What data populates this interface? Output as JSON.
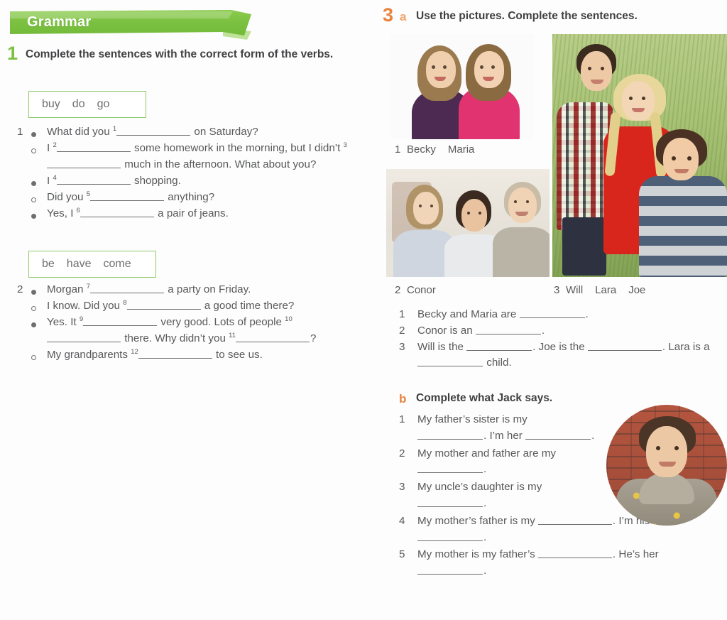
{
  "left": {
    "banner": {
      "label": "Grammar"
    },
    "exercise1": {
      "number": "1",
      "instruction": "Complete the sentences with the correct form of the verbs.",
      "verbbox1": {
        "v1": "buy",
        "v2": "do",
        "v3": "go"
      },
      "verbbox2": {
        "v1": "be",
        "v2": "have",
        "v3": "come"
      },
      "dialog1": {
        "number": "1",
        "lines": [
          {
            "bullet": "filled",
            "pre": "What did you ",
            "sup": "1",
            "mid": "",
            "post": " on Saturday?"
          },
          {
            "bullet": "hollow",
            "pre": "I ",
            "sup": "2",
            "mid": "",
            "post": " some homework in the morning, but I didn’t ",
            "sup2": "3",
            "post2": " much in the afternoon. What about you?"
          },
          {
            "bullet": "filled",
            "pre": "I ",
            "sup": "4",
            "post": " shopping."
          },
          {
            "bullet": "hollow",
            "pre": "Did you ",
            "sup": "5",
            "post": " anything?"
          },
          {
            "bullet": "filled",
            "pre": "Yes, I ",
            "sup": "6",
            "post": " a pair of jeans."
          }
        ]
      },
      "dialog2": {
        "number": "2",
        "lines": [
          {
            "bullet": "filled",
            "pre": "Morgan ",
            "sup": "7",
            "post": " a party on Friday."
          },
          {
            "bullet": "hollow",
            "pre": "I know. Did you ",
            "sup": "8",
            "post": " a good time there?"
          },
          {
            "bullet": "filled",
            "pre": "Yes. It ",
            "sup": "9",
            "post": " very good. Lots of people ",
            "sup2": "10",
            "post2": " there. Why didn’t you ",
            "sup3": "11",
            "post3": "?"
          },
          {
            "bullet": "hollow",
            "pre": "My grandparents ",
            "sup": "12",
            "post": " to see us."
          }
        ]
      }
    }
  },
  "right": {
    "exercise3": {
      "number": "3",
      "letter": "a",
      "instruction": "Use the pictures. Complete the sentences.",
      "captions": [
        {
          "number": "1",
          "names": [
            "Becky",
            "Maria"
          ]
        },
        {
          "number": "2",
          "names": [
            "Conor"
          ]
        },
        {
          "number": "3",
          "names": [
            "Will",
            "Lara",
            "Joe"
          ]
        }
      ],
      "photos": [
        {
          "alt_name": "photo-becky-maria"
        },
        {
          "alt_name": "photo-conor-family"
        },
        {
          "alt_name": "photo-will-lara-joe"
        }
      ],
      "sentences": [
        {
          "number": "1",
          "pre": "Becky and Maria are ",
          "post": "."
        },
        {
          "number": "2",
          "pre": "Conor is an ",
          "post": "."
        },
        {
          "number": "3",
          "pre": "Will is the ",
          "mid": ". Joe is the ",
          "post": ". Lara is a ",
          "tail": " child."
        }
      ]
    },
    "sectionb": {
      "letter": "b",
      "instruction": "Complete what Jack says.",
      "sentences": [
        {
          "number": "1",
          "pre": "My father’s sister is my ",
          "mid": ". I’m her ",
          "post": "."
        },
        {
          "number": "2",
          "pre": "My mother and father are my ",
          "post": "."
        },
        {
          "number": "3",
          "pre": "My uncle’s daughter is my ",
          "post": "."
        },
        {
          "number": "4",
          "pre": "My mother’s father is my ",
          "mid": ". I’m his ",
          "post": "."
        },
        {
          "number": "5",
          "pre": "My mother is my father’s ",
          "mid": ". He’s her ",
          "post": "."
        }
      ],
      "photo": {
        "alt_name": "photo-jack-portrait"
      }
    }
  },
  "colors": {
    "green": "#7cc141",
    "orange": "#e8823c",
    "orange_light": "#f0a46c",
    "text": "#58595b",
    "heading": "#3f4042"
  }
}
